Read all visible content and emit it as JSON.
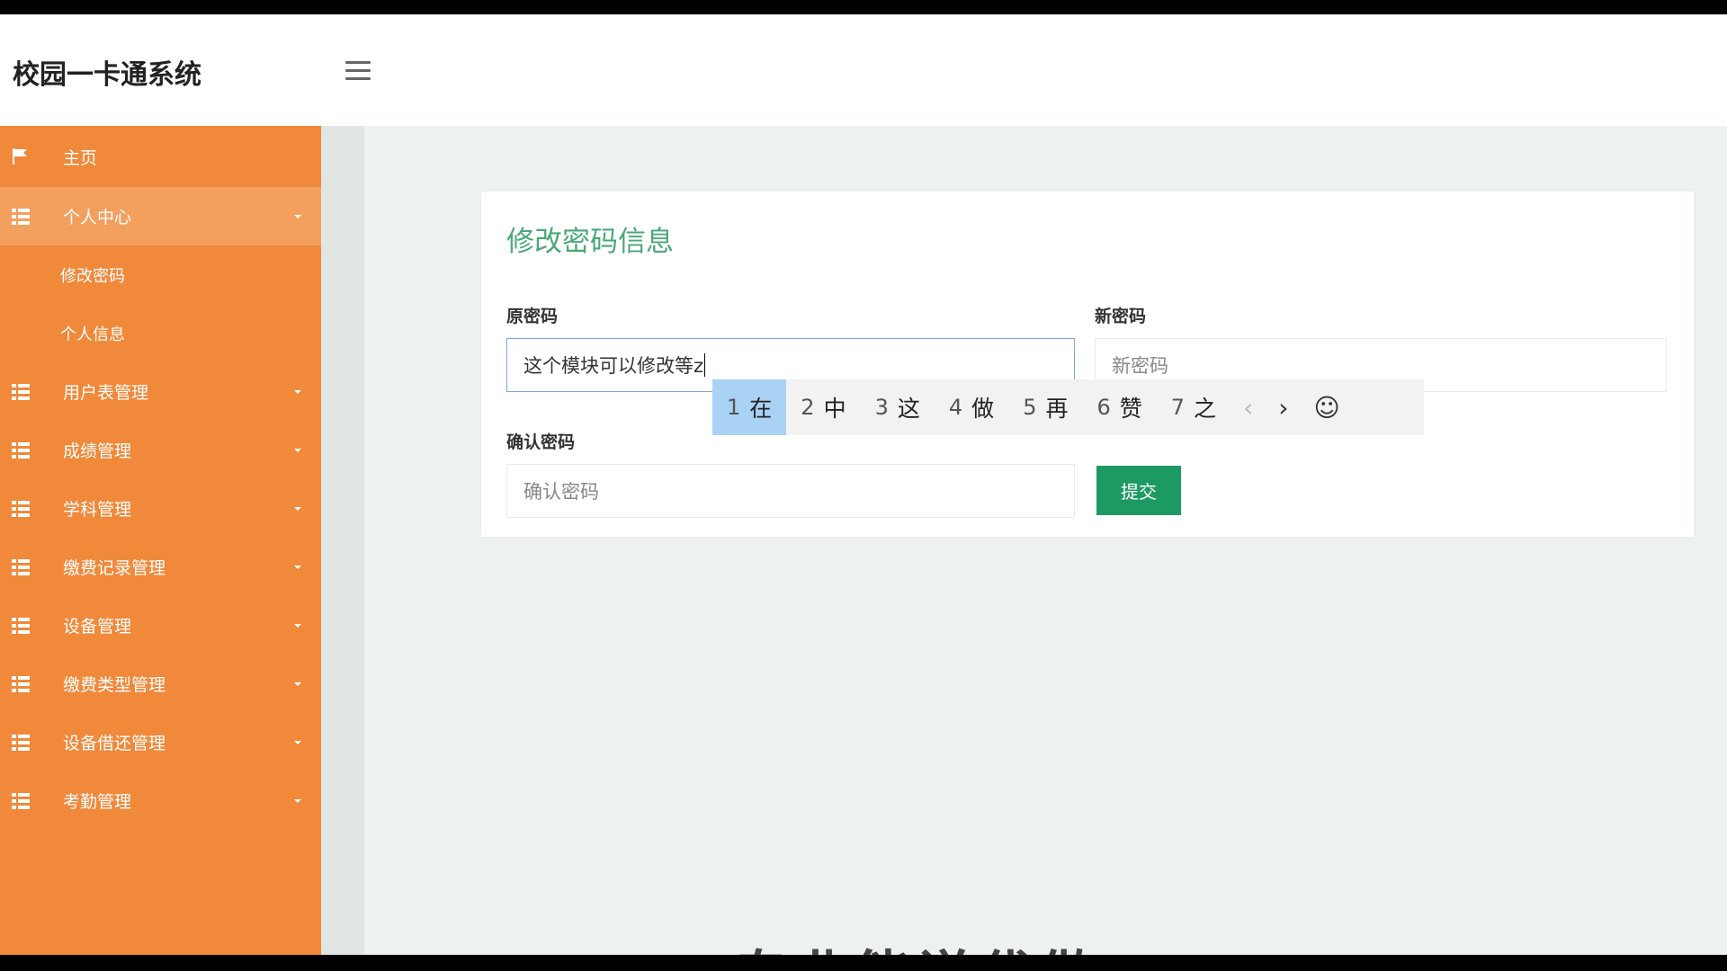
{
  "app": {
    "title": "校园一卡通系统"
  },
  "sidebar": {
    "home": "主页",
    "personal_center": "个人中心",
    "sub_items": [
      "修改密码",
      "个人信息"
    ],
    "items": [
      "用户表管理",
      "成绩管理",
      "学科管理",
      "缴费记录管理",
      "设备管理",
      "缴费类型管理",
      "设备借还管理",
      "考勤管理"
    ]
  },
  "form": {
    "title": "修改密码信息",
    "old_label": "原密码",
    "old_value": "这个模块可以修改等z",
    "new_label": "新密码",
    "new_placeholder": "新密码",
    "confirm_label": "确认密码",
    "confirm_placeholder": "确认密码",
    "submit": "提交"
  },
  "ime": {
    "candidates": [
      {
        "num": "1",
        "char": "在"
      },
      {
        "num": "2",
        "char": "中"
      },
      {
        "num": "3",
        "char": "这"
      },
      {
        "num": "4",
        "char": "做"
      },
      {
        "num": "5",
        "char": "再"
      },
      {
        "num": "6",
        "char": "赞"
      },
      {
        "num": "7",
        "char": "之"
      }
    ],
    "prev": "‹",
    "next": "›",
    "emoji": "☺"
  },
  "watermark": "专业能说代做",
  "colors": {
    "sidebar": "#f0893a",
    "accent": "#4aa876",
    "submit": "#1d9a63"
  }
}
